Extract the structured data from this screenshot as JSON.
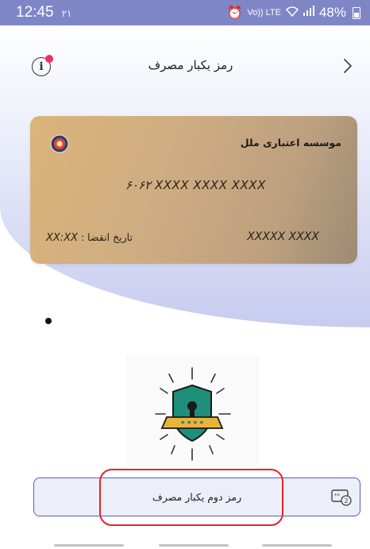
{
  "status_bar": {
    "time": "12:45",
    "time_suffix": "۲۱",
    "network_label": "Vo)) LTE",
    "battery_percent": "48%"
  },
  "header": {
    "title": "رمز یکبار مصرف",
    "notification_badge_color": "#ef2f64"
  },
  "card": {
    "bank_name": "موسسه اعتباری ملل",
    "card_number": "۶۰۶۲ XXXX XXXX XXXX",
    "expiry_label": "تاریخ انقضا :",
    "expiry_value": "XX:XX",
    "holder_name": "XXXXX XXXX",
    "gradient_colors": [
      "#dbb47a",
      "#bda07f",
      "#9d8a74"
    ]
  },
  "carousel": {
    "active_page": 1
  },
  "illustration": {
    "shield_color": "#1e8f7a",
    "banner_color": "#e8b53a",
    "mask_text": "* * * *"
  },
  "otp_button": {
    "label": "رمز دوم یکبار مصرف",
    "icon_badge": "2",
    "border_color": "#5560b7"
  },
  "colors": {
    "status_bar": "#7f86c6",
    "highlight": "#e3242b"
  }
}
